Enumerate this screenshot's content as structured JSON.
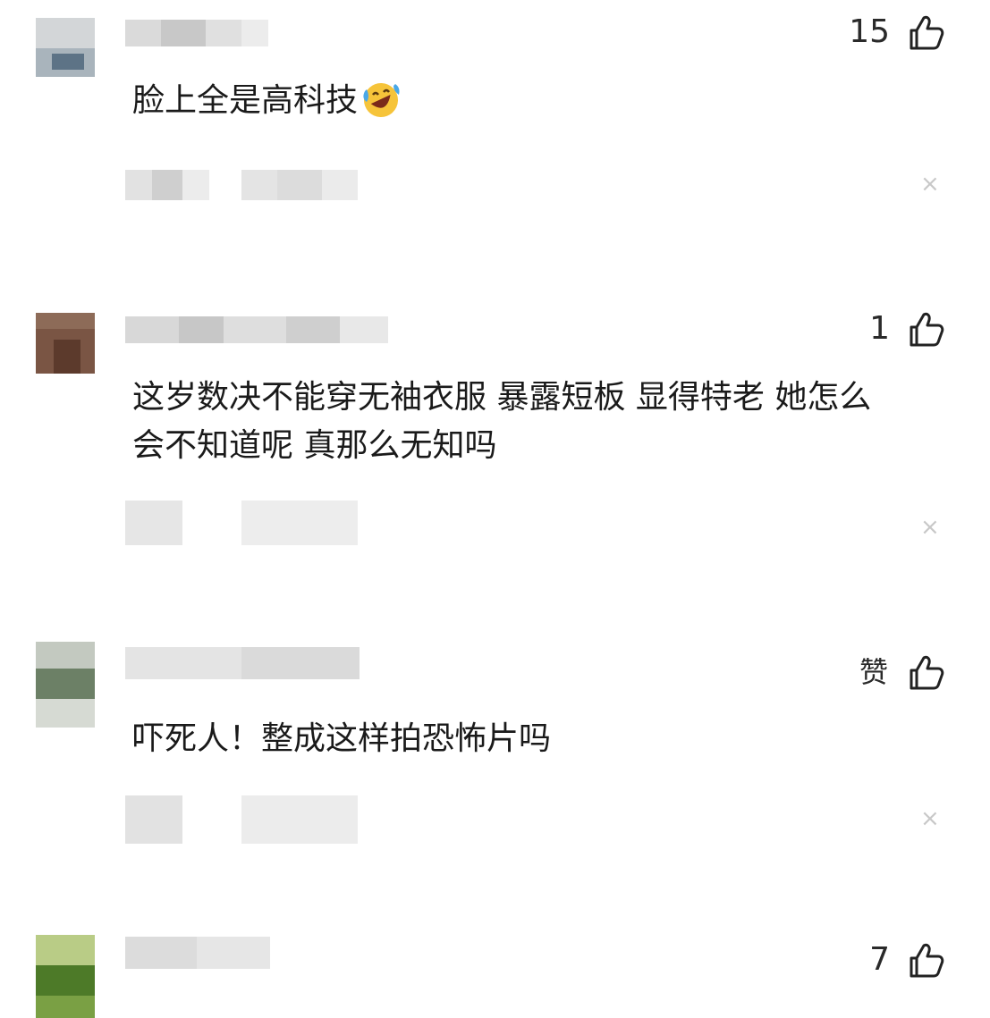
{
  "comments": [
    {
      "likes": "15",
      "text": "脸上全是高科技"
    },
    {
      "likes": "1",
      "text": "这岁数决不能穿无袖衣服 暴露短板 显得特老 她怎么\n会不知道呢 真那么无知吗"
    },
    {
      "likes": "赞",
      "text": "吓死人！整成这样拍恐怖片吗"
    },
    {
      "likes": "7",
      "text": ""
    }
  ],
  "icons": {
    "like": "thumbs-up-icon",
    "close": "close-icon",
    "emoji": "laughing-crying-emoji-icon"
  }
}
